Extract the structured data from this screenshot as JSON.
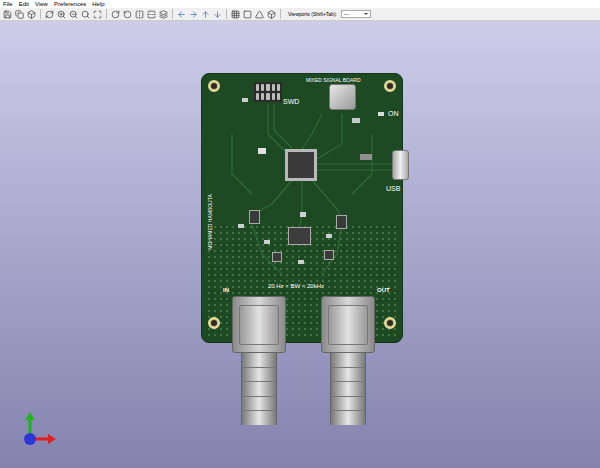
{
  "window": {
    "menu": [
      "File",
      "Edit",
      "View",
      "Preferences",
      "Help"
    ]
  },
  "toolbar": {
    "viewports_label": "Viewports (Shift+Tab):",
    "viewports_value": "---"
  },
  "board": {
    "title": "MIXED SIGNAL BOARD",
    "swd_label": "SWD",
    "power_label": "ON",
    "usb_label": "USB",
    "author": "MOHAMED HAMBOUTA",
    "bandwidth": "20 Hz < BW < 20kHz",
    "input_label": "IN",
    "output_label": "OUT"
  }
}
